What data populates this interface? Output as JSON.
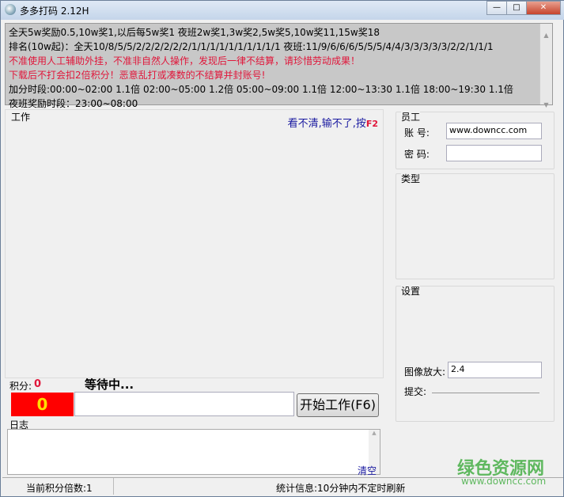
{
  "window": {
    "title": "多多打码 2.12H",
    "min": "—",
    "max": "□",
    "close": "✕"
  },
  "info": {
    "lines": [
      "全天5w奖励0.5,10w奖1,以后每5w奖1 夜班2w奖1,3w奖2,5w奖5,10w奖11,15w奖18",
      "排名(10w起)：全天10/8/5/5/2/2/2/2/2/2/1/1/1/1/1/1/1/1/1/1 夜班:11/9/6/6/6/5/5/5/4/4/3/3/3/3/3/2/2/1/1/1",
      "不准使用人工辅助外挂，不准非自然人操作，发现后一律不结算，请珍惜劳动成果！",
      "下载后不打会扣2倍积分！恶意乱打或凑数的不结算并封账号!",
      "加分时段:00:00~02:00 1.1倍  02:00~05:00 1.2倍  05:00~09:00 1.1倍  12:00~13:30 1.1倍  18:00~19:30 1.1倍",
      "夜班奖励时段：23:00~08:00"
    ]
  },
  "work": {
    "label": "工作",
    "hint": "看不清,输不了,按",
    "hint_key": "F2",
    "score_label": "积分:",
    "score": "0",
    "status": "等待中...",
    "counter": "0",
    "answer": "",
    "start_button": "开始工作(F6)"
  },
  "log": {
    "label": "日志",
    "content": "",
    "clear": "清空"
  },
  "employee": {
    "label": "员工",
    "account_label": "账  号:",
    "account": "www.downcc.com",
    "password_label": "密  码:",
    "password": ""
  },
  "type": {
    "label": "类型"
  },
  "settings": {
    "label": "设置",
    "zoom_label": "图像放大:",
    "zoom": "2.4",
    "submit_label": "提交:"
  },
  "statusbar": {
    "multiplier": "当前积分倍数:1",
    "stats": "统计信息:10分钟内不定时刷新"
  },
  "watermark": {
    "name": "绿色资源网",
    "url": "www.downcc.com"
  },
  "colors": {
    "red": "#e0163a",
    "counter_bg": "#ff0000",
    "counter_fg": "#ffe000",
    "link": "#1a1aa0"
  }
}
